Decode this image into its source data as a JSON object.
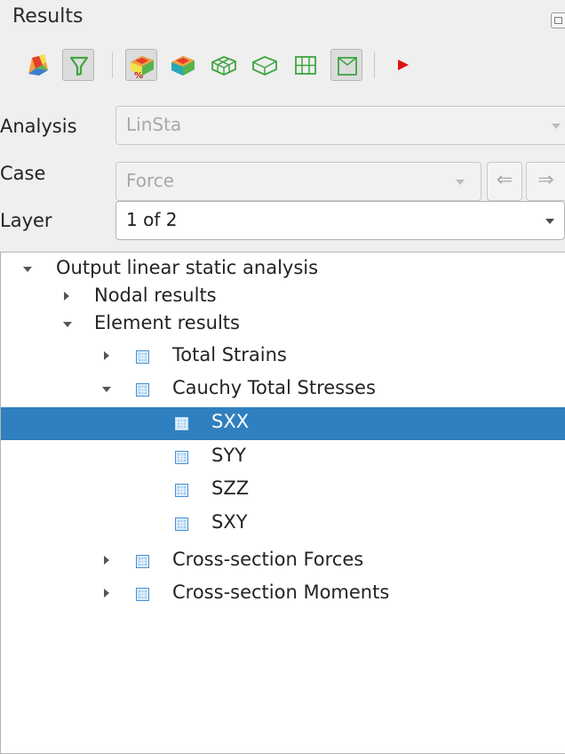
{
  "panel": {
    "title": "Results"
  },
  "toolbar": {
    "buttons": [
      {
        "icon": "color-scale-icon",
        "checked": false
      },
      {
        "icon": "filter-icon",
        "checked": true
      },
      {
        "icon": "contour-plot-icon",
        "checked": true
      },
      {
        "icon": "contour-surface-icon",
        "checked": false
      },
      {
        "icon": "deformed-mesh-icon",
        "checked": false
      },
      {
        "icon": "mesh-outline-icon",
        "checked": false
      },
      {
        "icon": "mesh-grid-icon",
        "checked": false
      },
      {
        "icon": "mesh-box-icon",
        "checked": true
      },
      {
        "icon": "play-icon",
        "checked": false
      }
    ]
  },
  "form": {
    "analysis": {
      "label": "Analysis",
      "value": "LinSta",
      "enabled": false
    },
    "case": {
      "label": "Case",
      "value": "Force",
      "enabled": false,
      "prev": "⇐",
      "next": "⇒"
    },
    "layer": {
      "label": "Layer",
      "value": "1 of 2",
      "enabled": true
    }
  },
  "tree": {
    "selected": "SXX",
    "items": [
      {
        "label": "Output linear static analysis",
        "depth": 0,
        "expander": "expanded",
        "icon": false
      },
      {
        "label": "Nodal results",
        "depth": 1,
        "expander": "collapsed",
        "icon": false
      },
      {
        "label": "Element results",
        "depth": 1,
        "expander": "expanded",
        "icon": false
      },
      {
        "label": "Total Strains",
        "depth": 2,
        "expander": "collapsed",
        "icon": true
      },
      {
        "label": "Cauchy Total Stresses",
        "depth": 2,
        "expander": "expanded",
        "icon": true
      },
      {
        "label": "SXX",
        "depth": 3,
        "expander": "none",
        "icon": true
      },
      {
        "label": "SYY",
        "depth": 3,
        "expander": "none",
        "icon": true
      },
      {
        "label": "SZZ",
        "depth": 3,
        "expander": "none",
        "icon": true
      },
      {
        "label": "SXY",
        "depth": 3,
        "expander": "none",
        "icon": true
      },
      {
        "label": "Cross-section Forces",
        "depth": 2,
        "expander": "collapsed",
        "icon": true
      },
      {
        "label": "Cross-section Moments",
        "depth": 2,
        "expander": "collapsed",
        "icon": true
      }
    ]
  },
  "colors": {
    "selection": "#3080c0",
    "play": "#e01010"
  }
}
